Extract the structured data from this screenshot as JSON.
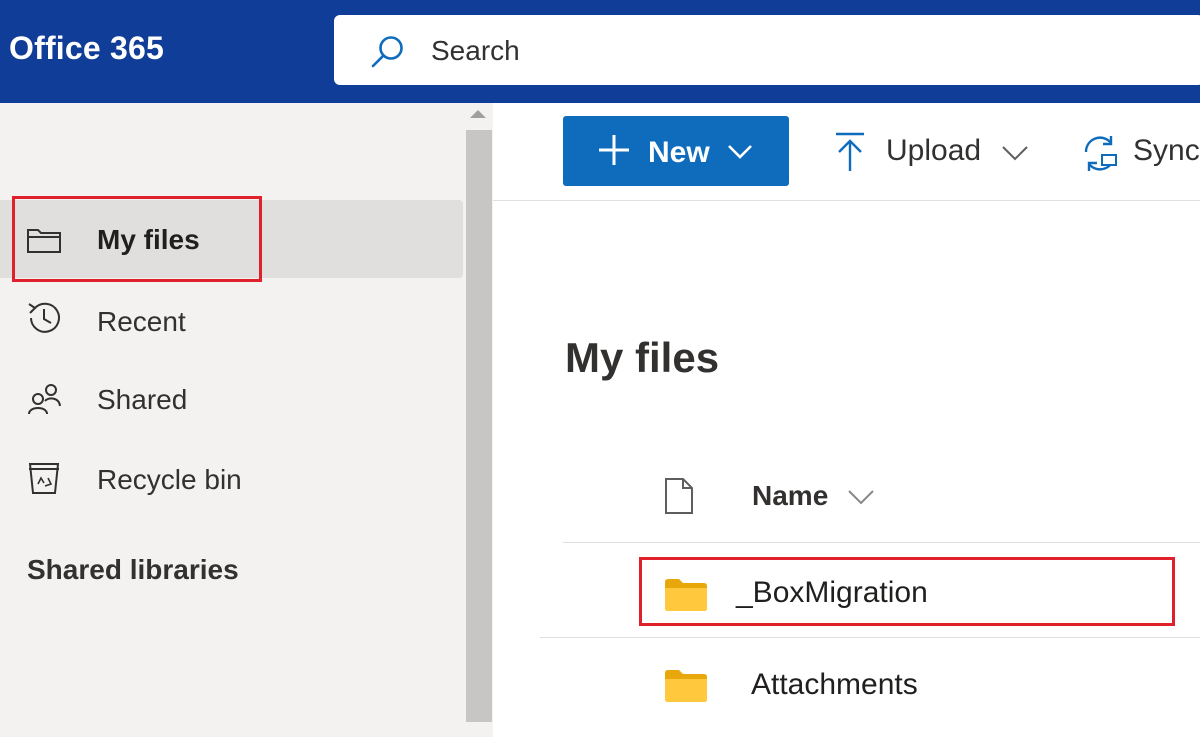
{
  "header": {
    "brand": "Office 365",
    "search_placeholder": "Search"
  },
  "sidebar": {
    "items": [
      {
        "label": "My files",
        "icon": "folder-icon",
        "active": true
      },
      {
        "label": "Recent",
        "icon": "clock-history-icon",
        "active": false
      },
      {
        "label": "Shared",
        "icon": "people-icon",
        "active": false
      },
      {
        "label": "Recycle bin",
        "icon": "recycle-bin-icon",
        "active": false
      }
    ],
    "section_title": "Shared libraries"
  },
  "commandbar": {
    "new_label": "New",
    "upload_label": "Upload",
    "sync_label": "Sync"
  },
  "main": {
    "title": "My files",
    "columns": {
      "name": "Name"
    },
    "rows": [
      {
        "name": "_BoxMigration",
        "icon": "folder-icon",
        "highlighted": true
      },
      {
        "name": "Attachments",
        "icon": "folder-icon",
        "highlighted": false
      }
    ]
  },
  "colors": {
    "header_bg": "#0f3d97",
    "primary_button": "#0f6cbd",
    "folder": "#ffc83d",
    "highlight_box": "#e0202b",
    "sidebar_bg": "#f3f2f1"
  }
}
